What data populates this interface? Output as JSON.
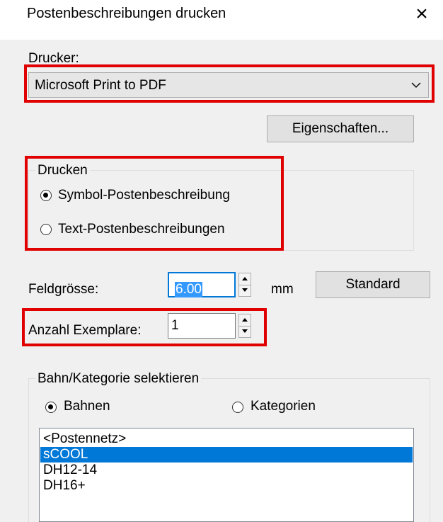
{
  "dialog": {
    "title": "Postenbeschreibungen drucken",
    "close_glyph": "×"
  },
  "printer": {
    "label": "Drucker:",
    "selected": "Microsoft Print to PDF",
    "properties_button": "Eigenschaften..."
  },
  "print_group": {
    "label": "Drucken",
    "options": [
      {
        "label": "Symbol-Postenbeschreibung",
        "checked": true
      },
      {
        "label": "Text-Postenbeschreibungen",
        "checked": false
      }
    ]
  },
  "field_size": {
    "label": "Feldgrösse:",
    "value": "6.00",
    "unit": "mm",
    "standard_button": "Standard"
  },
  "copies": {
    "label": "Anzahl Exemplare:",
    "value": "1"
  },
  "selection_group": {
    "label": "Bahn/Kategorie selektieren",
    "options": [
      {
        "label": "Bahnen",
        "checked": true
      },
      {
        "label": "Kategorien",
        "checked": false
      }
    ],
    "list_items": [
      "<Postennetz>",
      "sCOOL",
      "DH12-14",
      "DH16+"
    ],
    "selected_index": 1
  },
  "colors": {
    "highlight_box": "#e00000",
    "selection": "#0078d7"
  }
}
